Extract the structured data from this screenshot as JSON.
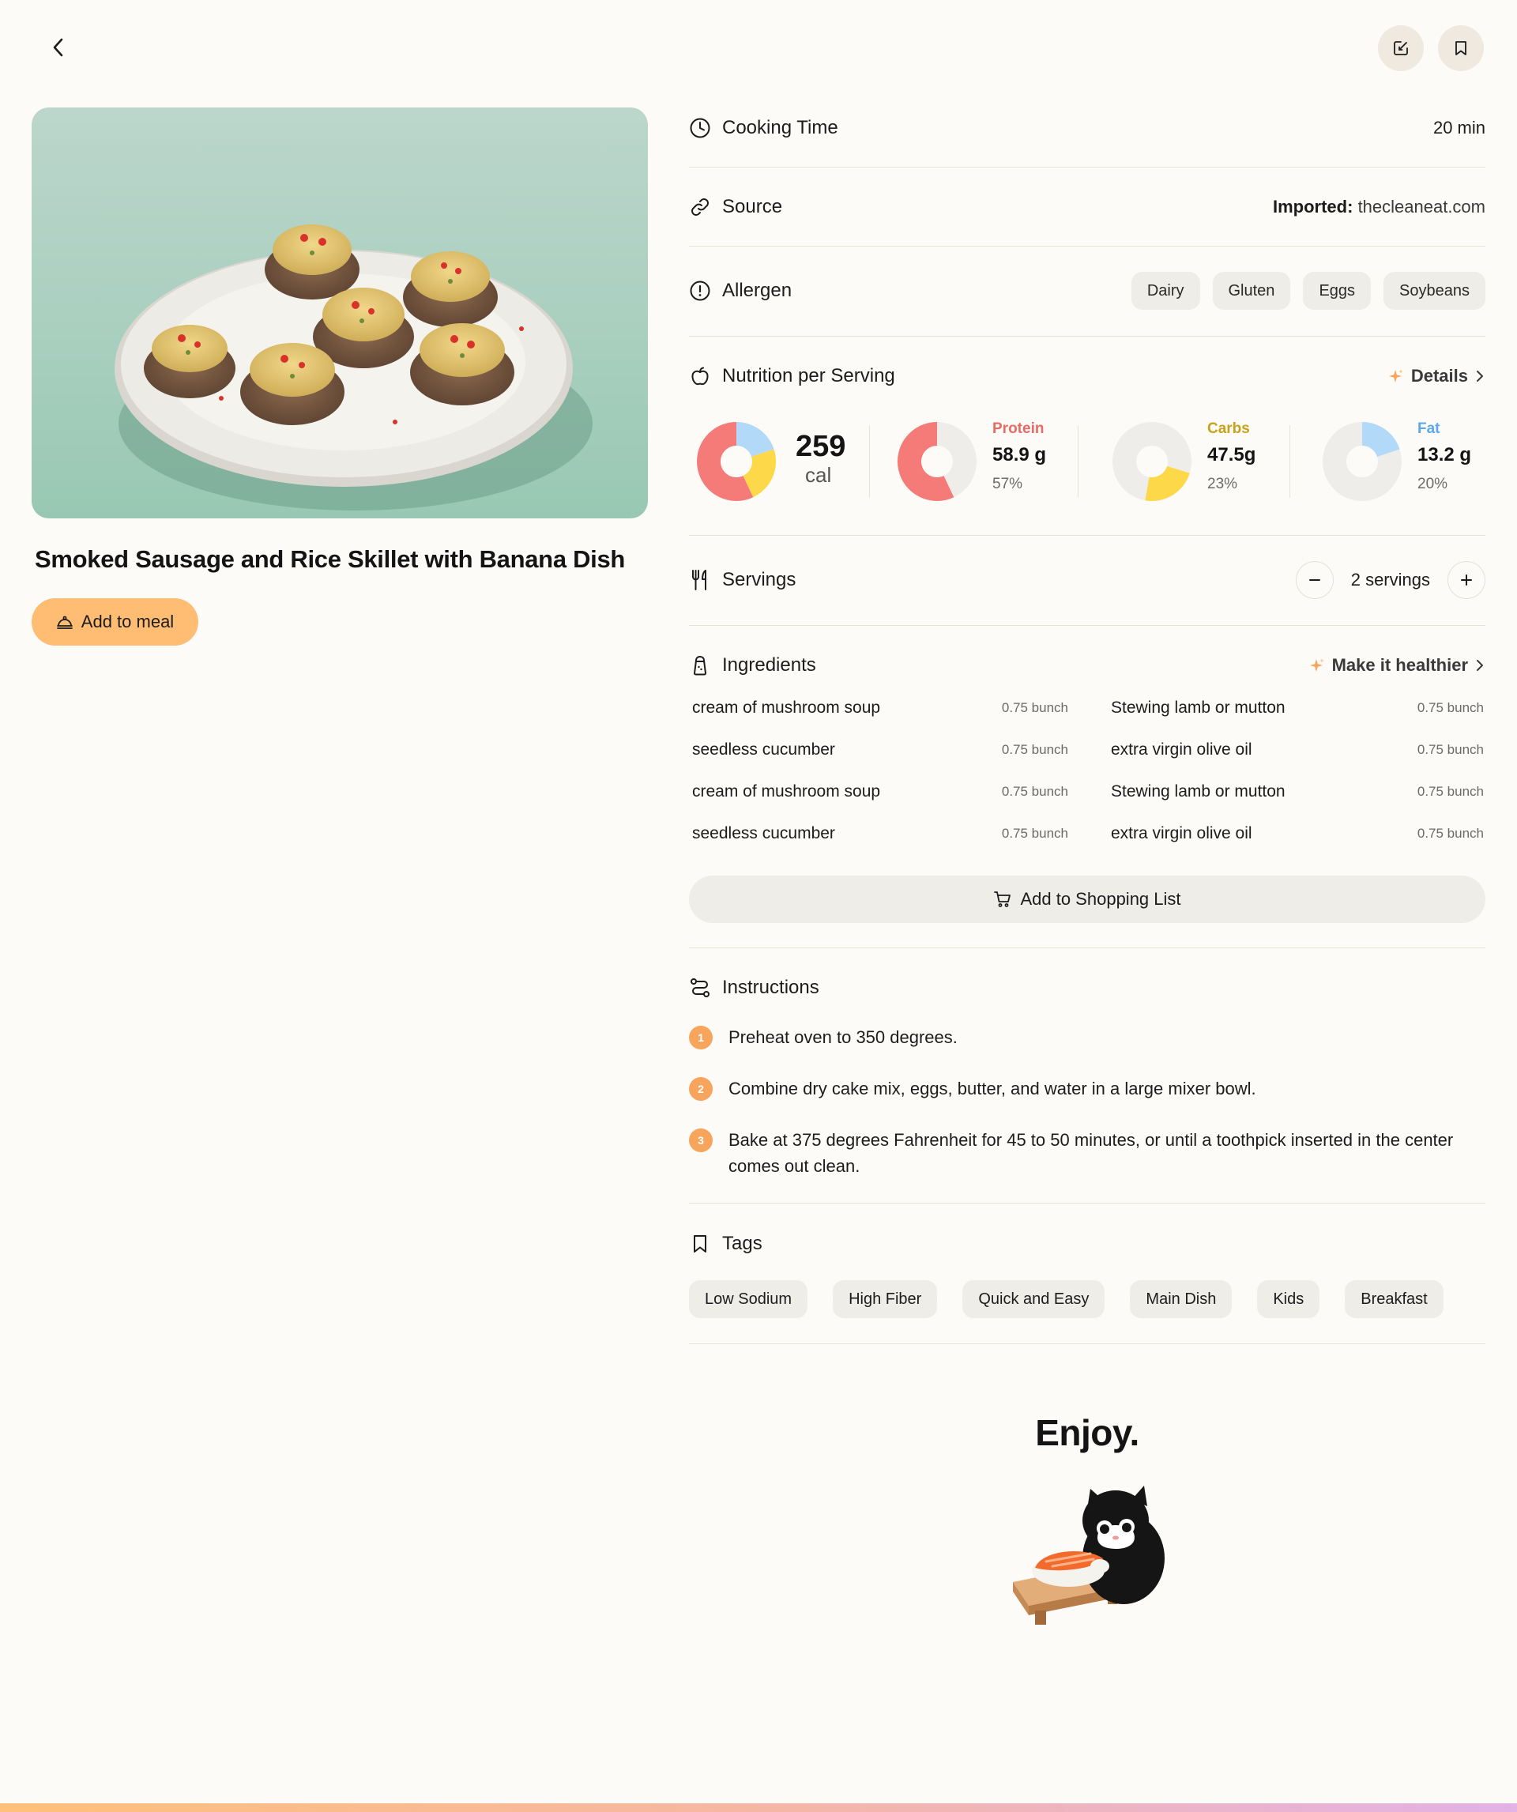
{
  "recipe": {
    "title": "Smoked Sausage and Rice Skillet with Banana Dish",
    "add_to_meal_label": "Add to meal"
  },
  "header": {
    "back_icon": "chevron-left-icon",
    "edit_icon": "edit-icon",
    "bookmark_icon": "bookmark-icon"
  },
  "cooking_time": {
    "label": "Cooking Time",
    "value": "20 min"
  },
  "source": {
    "label": "Source",
    "prefix": "Imported:",
    "site": "thecleaneat.com"
  },
  "allergen": {
    "label": "Allergen",
    "items": [
      "Dairy",
      "Gluten",
      "Eggs",
      "Soybeans"
    ]
  },
  "nutrition": {
    "label": "Nutrition per Serving",
    "details_label": "Details",
    "calories": {
      "value": "259",
      "unit": "cal"
    },
    "protein": {
      "name": "Protein",
      "amount": "58.9 g",
      "percent": "57%",
      "fraction": 0.57,
      "color": "#f47b77"
    },
    "carbs": {
      "name": "Carbs",
      "amount": "47.5g",
      "percent": "23%",
      "fraction": 0.23,
      "color": "#fdd94a"
    },
    "fat": {
      "name": "Fat",
      "amount": "13.2 g",
      "percent": "20%",
      "fraction": 0.2,
      "color": "#b3d9f8"
    },
    "name_colors": {
      "protein": "#e86a64",
      "carbs": "#c9a21b",
      "fat": "#5ba9ec"
    }
  },
  "servings": {
    "label": "Servings",
    "value": "2 servings"
  },
  "ingredients": {
    "label": "Ingredients",
    "healthier_label": "Make it healthier",
    "items": [
      {
        "name": "cream of mushroom soup",
        "qty": "0.75 bunch"
      },
      {
        "name": "Stewing lamb or mutton",
        "qty": "0.75 bunch"
      },
      {
        "name": "seedless cucumber",
        "qty": "0.75 bunch"
      },
      {
        "name": "extra virgin olive oil",
        "qty": "0.75 bunch"
      },
      {
        "name": "cream of mushroom soup",
        "qty": "0.75 bunch"
      },
      {
        "name": "Stewing lamb or mutton",
        "qty": "0.75 bunch"
      },
      {
        "name": "seedless cucumber",
        "qty": "0.75 bunch"
      },
      {
        "name": "extra virgin olive oil",
        "qty": "0.75 bunch"
      }
    ],
    "shopping_label": "Add to Shopping List"
  },
  "instructions": {
    "label": "Instructions",
    "steps": [
      {
        "num": "1",
        "text": "Preheat oven to 350 degrees."
      },
      {
        "num": "2",
        "text": "Combine dry cake mix, eggs, butter, and water in a large mixer bowl."
      },
      {
        "num": "3",
        "text": "Bake at 375 degrees Fahrenheit for 45 to 50 minutes, or until a toothpick inserted in the center comes out clean."
      }
    ]
  },
  "tags": {
    "label": "Tags",
    "items": [
      "Low Sodium",
      "High Fiber",
      "Quick and Easy",
      "Main Dish",
      "Kids",
      "Breakfast"
    ]
  },
  "footer": {
    "enjoy": "Enjoy."
  },
  "colors": {
    "accent": "#ffbd74",
    "background": "#fcfbf7",
    "chip": "#efede7",
    "step_badge": "#f7a55c"
  }
}
